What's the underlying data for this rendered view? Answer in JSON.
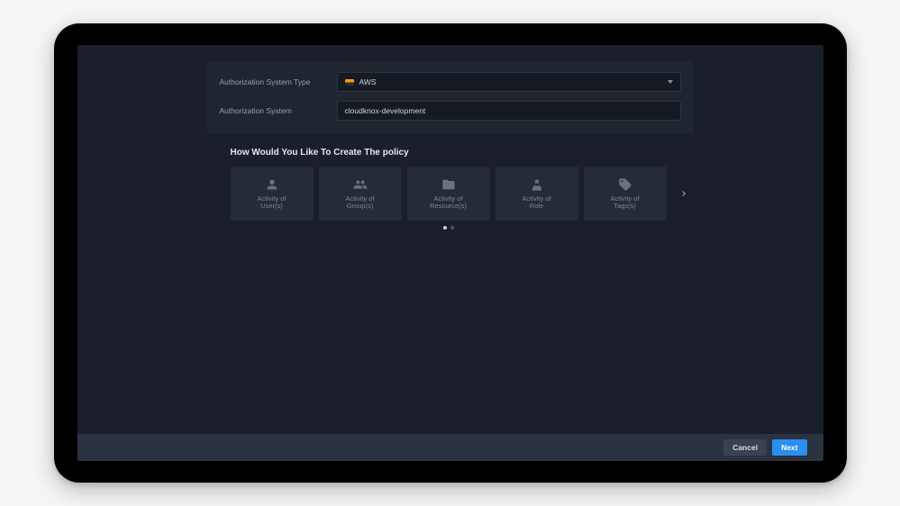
{
  "form": {
    "authTypeLabel": "Authorization System Type",
    "authTypeValue": "AWS",
    "authSystemLabel": "Authorization System",
    "authSystemValue": "cloudknox-development"
  },
  "sectionTitle": "How Would You Like To Create The policy",
  "cards": [
    {
      "line1": "Activity of",
      "line2": "User(s)"
    },
    {
      "line1": "Activity of",
      "line2": "Group(s)"
    },
    {
      "line1": "Activity of",
      "line2": "Resource(s)"
    },
    {
      "line1": "Activity of",
      "line2": "Role"
    },
    {
      "line1": "Activity of",
      "line2": "Tags(s)"
    }
  ],
  "footer": {
    "cancel": "Cancel",
    "next": "Next"
  }
}
